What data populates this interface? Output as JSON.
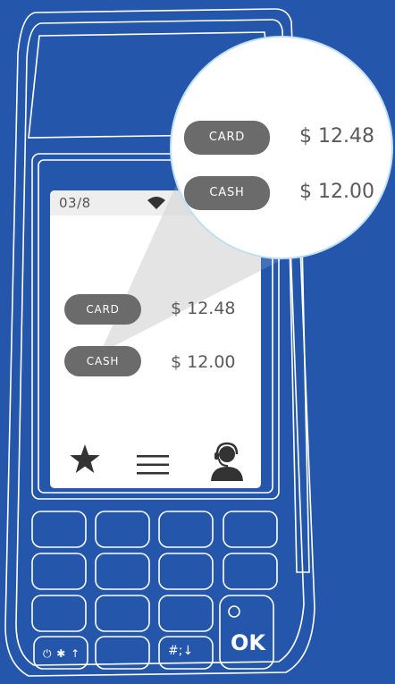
{
  "status_bar": {
    "time": "03/8",
    "wifi_icon": "wifi-icon"
  },
  "payment_options": [
    {
      "method": "CARD",
      "amount": "$ 12.48"
    },
    {
      "method": "CASH",
      "amount": "$ 12.00"
    }
  ],
  "bottom_nav": {
    "icons": [
      "star-icon",
      "menu-icon",
      "support-agent-icon"
    ]
  },
  "zoom_callout": {
    "options": [
      {
        "method": "CARD",
        "amount": "$ 12.48"
      },
      {
        "method": "CASH",
        "amount": "$ 12.00"
      }
    ]
  },
  "keypad": {
    "ok_label": "OK",
    "function_key_label": "⏻ ✱ ↑",
    "hash_key_label": "#;↓"
  },
  "colors": {
    "background": "#2457ab",
    "pill": "#6b6b6b",
    "amount_text": "#5a5a5a",
    "callout_border": "#bfe0f2"
  }
}
